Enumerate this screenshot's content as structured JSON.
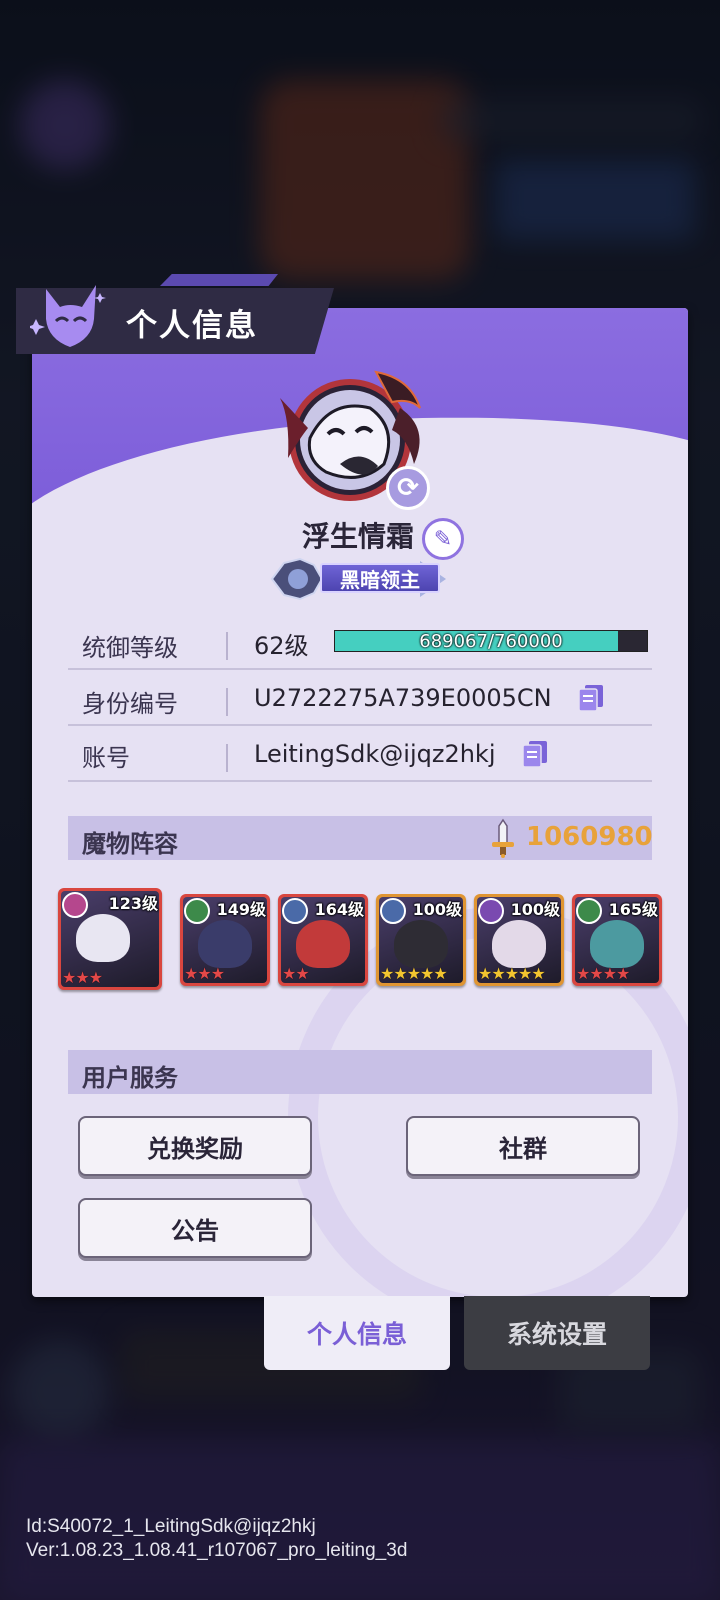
{
  "window": {
    "title": "个人信息"
  },
  "profile": {
    "player_name": "浮生情霜",
    "title_badge": "黑暗领主"
  },
  "info": {
    "level_label": "统御等级",
    "level_value": "62级",
    "exp_text": "689067/760000",
    "exp_progress": 0.9067,
    "id_label": "身份编号",
    "id_value": "U2722275A739E0005CN",
    "account_label": "账号",
    "account_value": "LeitingSdk@ijqz2hkj"
  },
  "lineup": {
    "label": "魔物阵容",
    "power": "1060980",
    "monsters": [
      {
        "level": "123级",
        "stars": "★★★",
        "star_color": "#e34848",
        "frame": "#d9463f",
        "elem_color": "#b5478d"
      },
      {
        "level": "149级",
        "stars": "★★★",
        "star_color": "#e34848",
        "frame": "#d9463f",
        "elem_color": "#3d8a4a"
      },
      {
        "level": "164级",
        "stars": "★★",
        "star_color": "#e34848",
        "frame": "#d9463f",
        "elem_color": "#4a6aa8"
      },
      {
        "level": "100级",
        "stars": "★★★★★",
        "star_color": "#f2c530",
        "frame": "#e09532",
        "elem_color": "#4a6aa8"
      },
      {
        "level": "100级",
        "stars": "★★★★★",
        "star_color": "#f2c530",
        "frame": "#e09532",
        "elem_color": "#7a4ab0"
      },
      {
        "level": "165级",
        "stars": "★★★★",
        "star_color": "#e34848",
        "frame": "#d9463f",
        "elem_color": "#3d8a4a"
      }
    ]
  },
  "services": {
    "label": "用户服务",
    "redeem": "兑换奖励",
    "community": "社群",
    "notice": "公告"
  },
  "tabs": {
    "profile": "个人信息",
    "settings": "系统设置"
  },
  "footer": {
    "id_line": "Id:S40072_1_LeitingSdk@ijqz2hkj",
    "ver_line": "Ver:1.08.23_1.08.41_r107067_pro_leiting_3d"
  },
  "colors": {
    "accent": "#7c5dd9",
    "panel": "#e6e1f3",
    "exp_fill": "#45cfc0",
    "power": "#e8a23a"
  },
  "icons": [
    "cat-mascot-icon",
    "refresh-icon",
    "edit-icon",
    "copy-icon",
    "sword-icon"
  ]
}
